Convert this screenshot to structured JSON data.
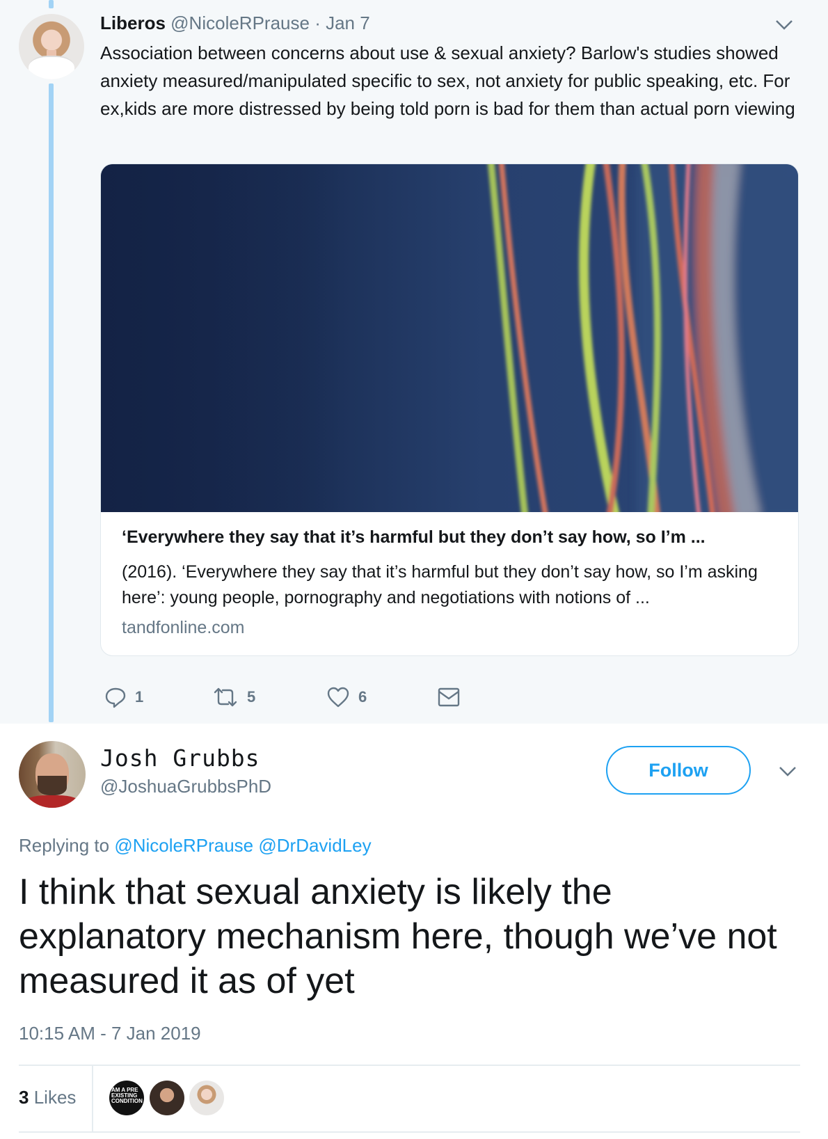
{
  "parent_tweet": {
    "author_name": "Liberos",
    "author_handle": "@NicoleRPrause",
    "date": "· Jan 7",
    "text": "Association between concerns about use & sexual anxiety? Barlow's studies showed anxiety measured/manipulated specific to sex, not anxiety for public speaking, etc. For ex,kids are more distressed by being told porn is bad for them than actual porn viewing",
    "card": {
      "title": "‘Everywhere they say that it’s harmful but they don’t say how, so I’m ...",
      "description": "(2016). ‘Everywhere they say that it’s harmful but they don’t say how, so I’m asking here’: young people, pornography and negotiations with notions of ...",
      "domain": "tandfonline.com"
    },
    "actions": {
      "reply_count": "1",
      "retweet_count": "5",
      "like_count": "6"
    }
  },
  "reply_tweet": {
    "author_name": "Josh Grubbs",
    "author_handle": "@JoshuaGrubbsPhD",
    "follow_label": "Follow",
    "replying_label": "Replying to",
    "mentions": [
      "@NicoleRPrause",
      "@DrDavidLey"
    ],
    "text": "I think that sexual anxiety is likely the explanatory mechanism here, though we’ve not measured it as of yet",
    "timestamp": "10:15 AM - 7 Jan 2019",
    "likes_count": "3",
    "likes_label": "Likes",
    "liker_1_badge": "AM A PRE EXISTING CONDITION"
  },
  "colors": {
    "accent": "#1da1f2",
    "muted_text": "#657786",
    "thread_line": "#a2d3f5",
    "parent_background": "#f5f8fa"
  },
  "icons": [
    "reply-icon",
    "retweet-icon",
    "like-icon",
    "direct-message-icon",
    "chevron-down-icon"
  ]
}
